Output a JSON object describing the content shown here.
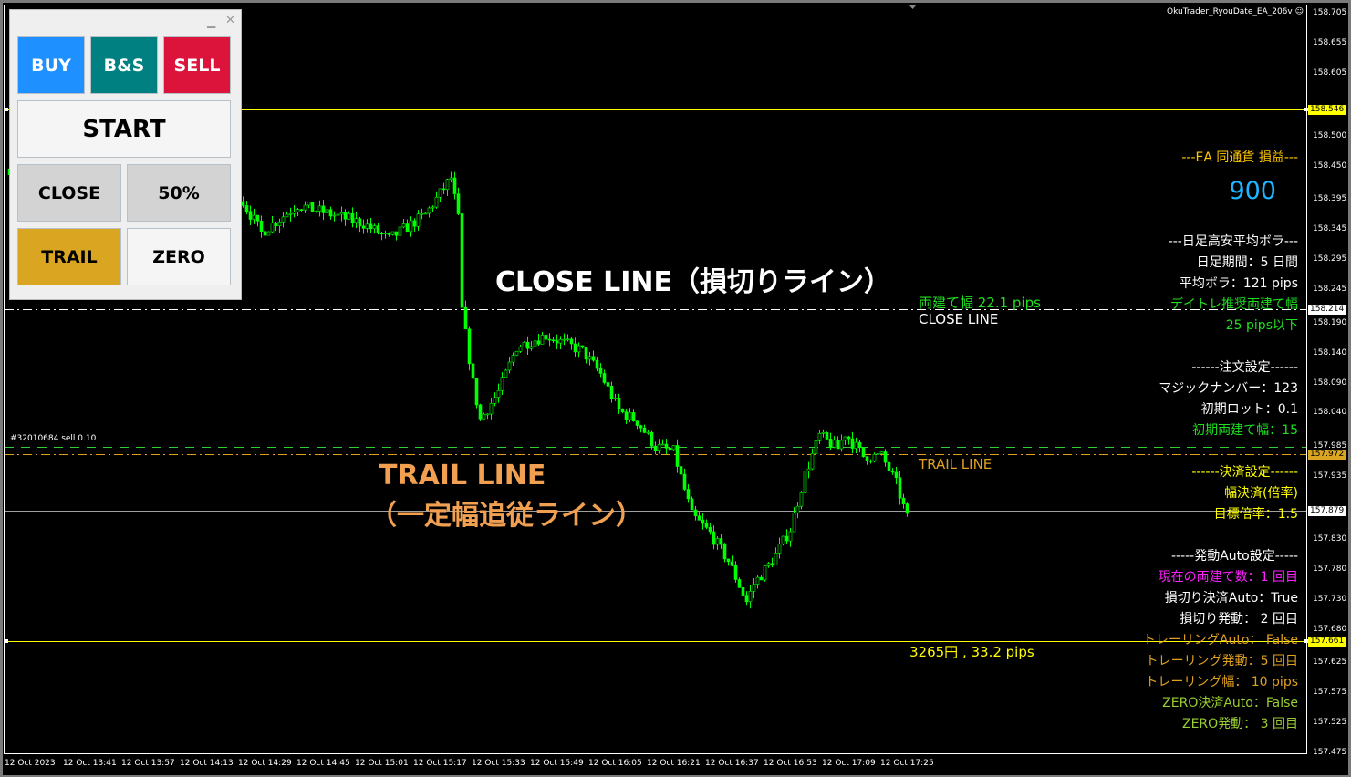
{
  "chart": {
    "ea_name": "OkuTrader_RyouDate_EA_206v",
    "smiley_icon": "smiley-icon",
    "candle_color": "#00ff00",
    "price_ticks": [
      "158.705",
      "158.655",
      "158.605",
      "158.500",
      "158.450",
      "158.395",
      "158.345",
      "158.295",
      "158.245",
      "158.190",
      "158.140",
      "158.090",
      "158.040",
      "157.985",
      "157.935",
      "157.830",
      "157.780",
      "157.730",
      "157.680",
      "157.625",
      "157.575",
      "157.525",
      "157.475"
    ],
    "time_ticks": [
      "12 Oct 2023",
      "12 Oct 13:41",
      "12 Oct 13:57",
      "12 Oct 14:13",
      "12 Oct 14:29",
      "12 Oct 14:45",
      "12 Oct 15:01",
      "12 Oct 15:17",
      "12 Oct 15:33",
      "12 Oct 15:49",
      "12 Oct 16:05",
      "12 Oct 16:21",
      "12 Oct 16:37",
      "12 Oct 16:53",
      "12 Oct 17:09",
      "12 Oct 17:25"
    ],
    "price_path": [
      [
        "13:26",
        158.447
      ],
      [
        "14:29",
        158.402
      ],
      [
        "14:35",
        158.341
      ],
      [
        "14:45",
        158.387
      ],
      [
        "15:03",
        158.356
      ],
      [
        "15:10",
        158.33
      ],
      [
        "15:20",
        158.371
      ],
      [
        "15:27",
        158.432
      ],
      [
        "15:29",
        158.364
      ],
      [
        "15:30",
        158.212
      ],
      [
        "15:33",
        158.091
      ],
      [
        "15:35",
        158.03
      ],
      [
        "15:40",
        158.076
      ],
      [
        "15:45",
        158.151
      ],
      [
        "15:53",
        158.17
      ],
      [
        "16:03",
        158.144
      ],
      [
        "16:08",
        158.106
      ],
      [
        "16:13",
        158.045
      ],
      [
        "16:18",
        158.027
      ],
      [
        "16:23",
        157.985
      ],
      [
        "16:28",
        157.977
      ],
      [
        "16:33",
        157.871
      ],
      [
        "16:38",
        157.841
      ],
      [
        "16:43",
        157.795
      ],
      [
        "16:48",
        157.727
      ],
      [
        "16:50",
        157.757
      ],
      [
        "16:55",
        157.795
      ],
      [
        "17:00",
        157.848
      ],
      [
        "17:04",
        157.939
      ],
      [
        "17:08",
        158.003
      ],
      [
        "17:13",
        157.982
      ],
      [
        "17:15",
        158.007
      ],
      [
        "17:20",
        157.969
      ],
      [
        "17:25",
        157.969
      ],
      [
        "17:29",
        157.924
      ],
      [
        "17:32",
        157.866
      ]
    ],
    "lines": [
      {
        "name": "upper-yellow-line",
        "price": "158.546",
        "color": "#ffff00",
        "style": "solid",
        "tag_bg": "#ffff00",
        "tag_fg": "#000"
      },
      {
        "name": "close-line",
        "price": "158.214",
        "color": "#ffffff",
        "style": "dashdot",
        "tag_bg": "#ffffff",
        "tag_fg": "#000"
      },
      {
        "name": "order-line",
        "price": "157.985",
        "color": "#32cd32",
        "style": "dash",
        "tag_bg": null,
        "tag_fg": null
      },
      {
        "name": "trail-line",
        "price": "157.972",
        "color": "#e0a020",
        "style": "dashdot",
        "tag_bg": "#daa520",
        "tag_fg": "#000"
      },
      {
        "name": "bid-line",
        "price": "157.879",
        "color": "#a0a0a0",
        "style": "solid",
        "tag_bg": "#ffffff",
        "tag_fg": "#000"
      },
      {
        "name": "lower-yellow-line",
        "price": "157.661",
        "color": "#ffff00",
        "style": "solid",
        "tag_bg": "#ffff00",
        "tag_fg": "#000"
      }
    ],
    "order_label": "#32010684 sell 0.10",
    "close_line_width_label": "両建て幅 22.1 pips",
    "close_line_label": "CLOSE LINE",
    "trail_line_label": "TRAIL LINE",
    "lower_line_label": "3265円 , 33.2 pips",
    "annotation_close": "CLOSE LINE（損切りライン）",
    "annotation_trail_1": "TRAIL LINE",
    "annotation_trail_2": "（一定幅追従ライン）"
  },
  "info": [
    {
      "text": "---EA 同通貨 損益---",
      "color": "#ffc800"
    },
    {
      "text": "900",
      "color": "#1eb4ff"
    },
    {
      "text": "---日足高安平均ボラ---",
      "color": "#ffffff"
    },
    {
      "text": "日足期間：5 日間",
      "color": "#ffffff"
    },
    {
      "text": "平均ボラ：121 pips",
      "color": "#ffffff"
    },
    {
      "text": "デイトレ推奨両建て幅",
      "color": "#20e020"
    },
    {
      "text": "25 pips以下",
      "color": "#20e020"
    },
    {
      "text": "------注文設定------",
      "color": "#ffffff"
    },
    {
      "text": "マジックナンバー：123",
      "color": "#ffffff"
    },
    {
      "text": "初期ロット：0.1",
      "color": "#ffffff"
    },
    {
      "text": "初期両建て幅：15",
      "color": "#20e020"
    },
    {
      "text": "------決済設定------",
      "color": "#ffff00"
    },
    {
      "text": "幅決済(倍率)",
      "color": "#ffff00"
    },
    {
      "text": "目標倍率：1.5",
      "color": "#ffff00"
    },
    {
      "text": "-----発動Auto設定-----",
      "color": "#ffffff"
    },
    {
      "text": "現在の両建て数：1 回目",
      "color": "#ff20ff"
    },
    {
      "text": "損切り決済Auto：True",
      "color": "#ffffff"
    },
    {
      "text": "損切り発動： 2 回目",
      "color": "#ffffff"
    },
    {
      "text": "トレーリングAuto： False",
      "color": "#e0a020"
    },
    {
      "text": "トレーリング発動：5 回目",
      "color": "#e0a020"
    },
    {
      "text": "トレーリング幅： 10 pips",
      "color": "#e0a020"
    },
    {
      "text": "ZERO決済Auto：False",
      "color": "#9acd32"
    },
    {
      "text": "ZERO発動： 3 回目",
      "color": "#9acd32"
    }
  ],
  "panel": {
    "minimize_icon": "minimize-icon",
    "close_icon": "close-icon",
    "buttons": [
      {
        "label": "BUY",
        "bg": "#1e90ff",
        "fg": "#ffffff"
      },
      {
        "label": "B&S",
        "bg": "#008080",
        "fg": "#ffffff"
      },
      {
        "label": "SELL",
        "bg": "#dc143c",
        "fg": "#ffffff"
      },
      {
        "label": "START",
        "bg": "#f5f5f5",
        "fg": "#000000"
      },
      {
        "label": "CLOSE",
        "bg": "#d3d3d3",
        "fg": "#000000"
      },
      {
        "label": "50%",
        "bg": "#d3d3d3",
        "fg": "#000000"
      },
      {
        "label": "TRAIL",
        "bg": "#daa520",
        "fg": "#000000"
      },
      {
        "label": "ZERO",
        "bg": "#f5f5f5",
        "fg": "#000000"
      }
    ]
  }
}
